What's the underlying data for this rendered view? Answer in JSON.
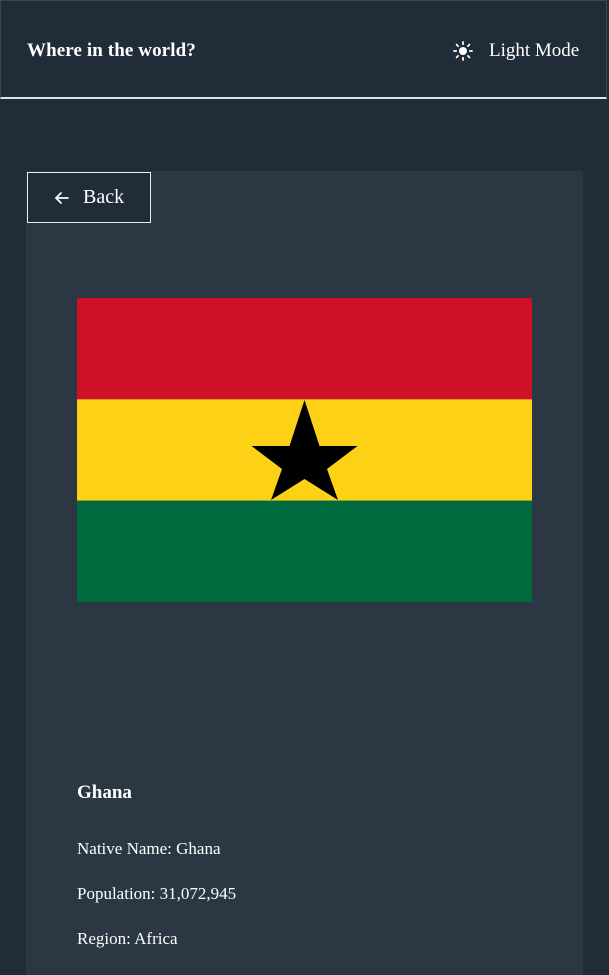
{
  "header": {
    "title": "Where in the world?",
    "theme_toggle_label": "Light Mode",
    "theme_icon": "sun-icon"
  },
  "back_button": {
    "label": "Back",
    "icon": "arrow-left-icon"
  },
  "country": {
    "name": "Ghana",
    "flag_colors": {
      "top": "#ce1126",
      "middle": "#fcd116",
      "bottom": "#006b3f",
      "star": "#000000"
    },
    "details": {
      "native_name_label": "Native Name:",
      "native_name": "Ghana",
      "population_label": "Population:",
      "population": "31,072,945",
      "region_label": "Region:",
      "region": "Africa"
    }
  },
  "colors": {
    "background": "#202c37",
    "card": "#2b3743",
    "text": "#ffffff"
  }
}
